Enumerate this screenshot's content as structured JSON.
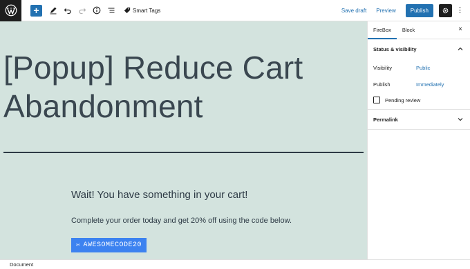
{
  "toolbar": {
    "logo_icon": "wordpress-logo",
    "add_label": "+",
    "smart_tags_label": "Smart Tags",
    "save_draft_label": "Save draft",
    "preview_label": "Preview",
    "publish_label": "Publish",
    "more_label": "⋮",
    "accent_color": "#2271b1"
  },
  "editor": {
    "background_color": "#d3e3de",
    "title": "[Popup] Reduce Cart Abandonment",
    "popup": {
      "heading": "Wait! You have something in your cart!",
      "body": "Complete your order today and get 20% off using the code below.",
      "code_icon": "✄",
      "code": "AWESOMECODE20",
      "button_color": "#3c82f0"
    }
  },
  "sidebar": {
    "tabs": [
      "FireBox",
      "Block"
    ],
    "close_label": "×",
    "status_panel": {
      "title": "Status & visibility",
      "visibility_label": "Visibility",
      "visibility_value": "Public",
      "publish_label": "Publish",
      "publish_value": "Immediately",
      "pending_review_label": "Pending review"
    },
    "permalink_panel": {
      "title": "Permalink"
    }
  },
  "footer": {
    "breadcrumb": "Document"
  }
}
